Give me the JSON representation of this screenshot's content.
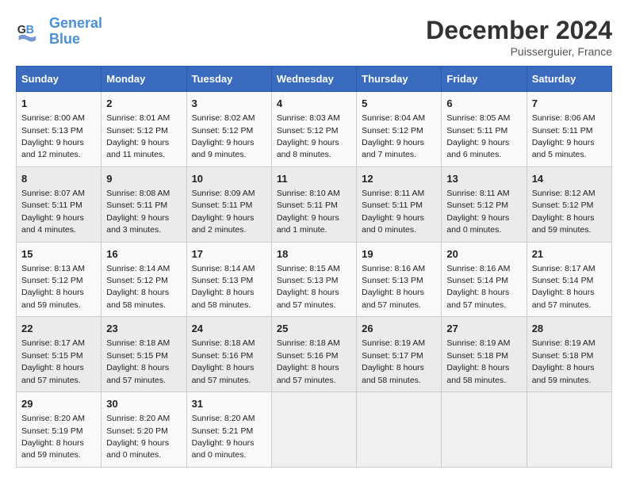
{
  "header": {
    "logo_line1": "General",
    "logo_line2": "Blue",
    "month": "December 2024",
    "location": "Puisserguier, France"
  },
  "weekdays": [
    "Sunday",
    "Monday",
    "Tuesday",
    "Wednesday",
    "Thursday",
    "Friday",
    "Saturday"
  ],
  "weeks": [
    [
      {
        "day": 1,
        "sunrise": "8:00 AM",
        "sunset": "5:13 PM",
        "daylight": "9 hours and 12 minutes."
      },
      {
        "day": 2,
        "sunrise": "8:01 AM",
        "sunset": "5:12 PM",
        "daylight": "9 hours and 11 minutes."
      },
      {
        "day": 3,
        "sunrise": "8:02 AM",
        "sunset": "5:12 PM",
        "daylight": "9 hours and 9 minutes."
      },
      {
        "day": 4,
        "sunrise": "8:03 AM",
        "sunset": "5:12 PM",
        "daylight": "9 hours and 8 minutes."
      },
      {
        "day": 5,
        "sunrise": "8:04 AM",
        "sunset": "5:12 PM",
        "daylight": "9 hours and 7 minutes."
      },
      {
        "day": 6,
        "sunrise": "8:05 AM",
        "sunset": "5:11 PM",
        "daylight": "9 hours and 6 minutes."
      },
      {
        "day": 7,
        "sunrise": "8:06 AM",
        "sunset": "5:11 PM",
        "daylight": "9 hours and 5 minutes."
      }
    ],
    [
      {
        "day": 8,
        "sunrise": "8:07 AM",
        "sunset": "5:11 PM",
        "daylight": "9 hours and 4 minutes."
      },
      {
        "day": 9,
        "sunrise": "8:08 AM",
        "sunset": "5:11 PM",
        "daylight": "9 hours and 3 minutes."
      },
      {
        "day": 10,
        "sunrise": "8:09 AM",
        "sunset": "5:11 PM",
        "daylight": "9 hours and 2 minutes."
      },
      {
        "day": 11,
        "sunrise": "8:10 AM",
        "sunset": "5:11 PM",
        "daylight": "9 hours and 1 minute."
      },
      {
        "day": 12,
        "sunrise": "8:11 AM",
        "sunset": "5:11 PM",
        "daylight": "9 hours and 0 minutes."
      },
      {
        "day": 13,
        "sunrise": "8:11 AM",
        "sunset": "5:12 PM",
        "daylight": "9 hours and 0 minutes."
      },
      {
        "day": 14,
        "sunrise": "8:12 AM",
        "sunset": "5:12 PM",
        "daylight": "8 hours and 59 minutes."
      }
    ],
    [
      {
        "day": 15,
        "sunrise": "8:13 AM",
        "sunset": "5:12 PM",
        "daylight": "8 hours and 59 minutes."
      },
      {
        "day": 16,
        "sunrise": "8:14 AM",
        "sunset": "5:12 PM",
        "daylight": "8 hours and 58 minutes."
      },
      {
        "day": 17,
        "sunrise": "8:14 AM",
        "sunset": "5:13 PM",
        "daylight": "8 hours and 58 minutes."
      },
      {
        "day": 18,
        "sunrise": "8:15 AM",
        "sunset": "5:13 PM",
        "daylight": "8 hours and 57 minutes."
      },
      {
        "day": 19,
        "sunrise": "8:16 AM",
        "sunset": "5:13 PM",
        "daylight": "8 hours and 57 minutes."
      },
      {
        "day": 20,
        "sunrise": "8:16 AM",
        "sunset": "5:14 PM",
        "daylight": "8 hours and 57 minutes."
      },
      {
        "day": 21,
        "sunrise": "8:17 AM",
        "sunset": "5:14 PM",
        "daylight": "8 hours and 57 minutes."
      }
    ],
    [
      {
        "day": 22,
        "sunrise": "8:17 AM",
        "sunset": "5:15 PM",
        "daylight": "8 hours and 57 minutes."
      },
      {
        "day": 23,
        "sunrise": "8:18 AM",
        "sunset": "5:15 PM",
        "daylight": "8 hours and 57 minutes."
      },
      {
        "day": 24,
        "sunrise": "8:18 AM",
        "sunset": "5:16 PM",
        "daylight": "8 hours and 57 minutes."
      },
      {
        "day": 25,
        "sunrise": "8:18 AM",
        "sunset": "5:16 PM",
        "daylight": "8 hours and 57 minutes."
      },
      {
        "day": 26,
        "sunrise": "8:19 AM",
        "sunset": "5:17 PM",
        "daylight": "8 hours and 58 minutes."
      },
      {
        "day": 27,
        "sunrise": "8:19 AM",
        "sunset": "5:18 PM",
        "daylight": "8 hours and 58 minutes."
      },
      {
        "day": 28,
        "sunrise": "8:19 AM",
        "sunset": "5:18 PM",
        "daylight": "8 hours and 59 minutes."
      }
    ],
    [
      {
        "day": 29,
        "sunrise": "8:20 AM",
        "sunset": "5:19 PM",
        "daylight": "8 hours and 59 minutes."
      },
      {
        "day": 30,
        "sunrise": "8:20 AM",
        "sunset": "5:20 PM",
        "daylight": "9 hours and 0 minutes."
      },
      {
        "day": 31,
        "sunrise": "8:20 AM",
        "sunset": "5:21 PM",
        "daylight": "9 hours and 0 minutes."
      },
      null,
      null,
      null,
      null
    ]
  ]
}
